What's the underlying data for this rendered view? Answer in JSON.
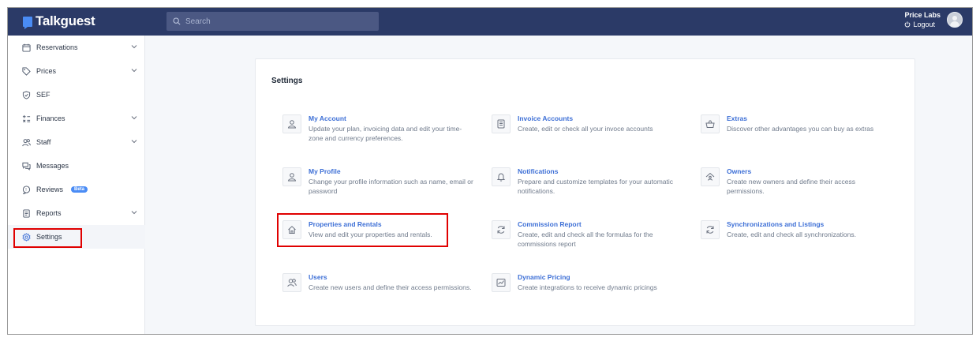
{
  "app": {
    "name": "Talkguest"
  },
  "search": {
    "placeholder": "Search"
  },
  "user": {
    "name": "Price Labs",
    "logout_label": "Logout"
  },
  "sidebar": {
    "items": [
      {
        "label": "Reservations",
        "icon": "calendar-icon",
        "has_submenu": true
      },
      {
        "label": "Prices",
        "icon": "tag-icon",
        "has_submenu": true
      },
      {
        "label": "SEF",
        "icon": "shield-icon",
        "has_submenu": false
      },
      {
        "label": "Finances",
        "icon": "calculator-icon",
        "has_submenu": true
      },
      {
        "label": "Staff",
        "icon": "users-icon",
        "has_submenu": true
      },
      {
        "label": "Messages",
        "icon": "chat-icon",
        "has_submenu": false
      },
      {
        "label": "Reviews",
        "icon": "star-chat-icon",
        "has_submenu": false,
        "badge": "Beta"
      },
      {
        "label": "Reports",
        "icon": "report-icon",
        "has_submenu": true
      },
      {
        "label": "Settings",
        "icon": "gear-icon",
        "has_submenu": false,
        "active": true
      }
    ]
  },
  "settings": {
    "title": "Settings",
    "tiles": [
      {
        "title": "My Account",
        "description": "Update your plan, invoicing data and edit your time-zone and currency preferences.",
        "icon": "user-icon"
      },
      {
        "title": "Invoice Accounts",
        "description": "Create, edit or check all your invoce accounts",
        "icon": "invoice-icon"
      },
      {
        "title": "Extras",
        "description": "Discover other advantages you can buy as extras",
        "icon": "basket-icon"
      },
      {
        "title": "My Profile",
        "description": "Change your profile information such as name, email or password",
        "icon": "user-icon"
      },
      {
        "title": "Notifications",
        "description": "Prepare and customize templates for your automatic notifications.",
        "icon": "bell-icon"
      },
      {
        "title": "Owners",
        "description": "Create new owners and define their access permissions.",
        "icon": "owner-house-icon"
      },
      {
        "title": "Properties and Rentals",
        "description": "View and edit your properties and rentals.",
        "icon": "house-icon"
      },
      {
        "title": "Commission Report",
        "description": "Create, edit and check all the formulas for the commissions report",
        "icon": "refresh-icon"
      },
      {
        "title": "Synchronizations and Listings",
        "description": "Create, edit and check all synchronizations.",
        "icon": "sync-icon"
      },
      {
        "title": "Users",
        "description": "Create new users and define their access permissions.",
        "icon": "users-icon"
      },
      {
        "title": "Dynamic Pricing",
        "description": "Create integrations to receive dynamic pricings",
        "icon": "chart-icon"
      }
    ]
  },
  "colors": {
    "topbar": "#2b3a67",
    "accent": "#3d6fd6",
    "highlight": "#e00000"
  }
}
